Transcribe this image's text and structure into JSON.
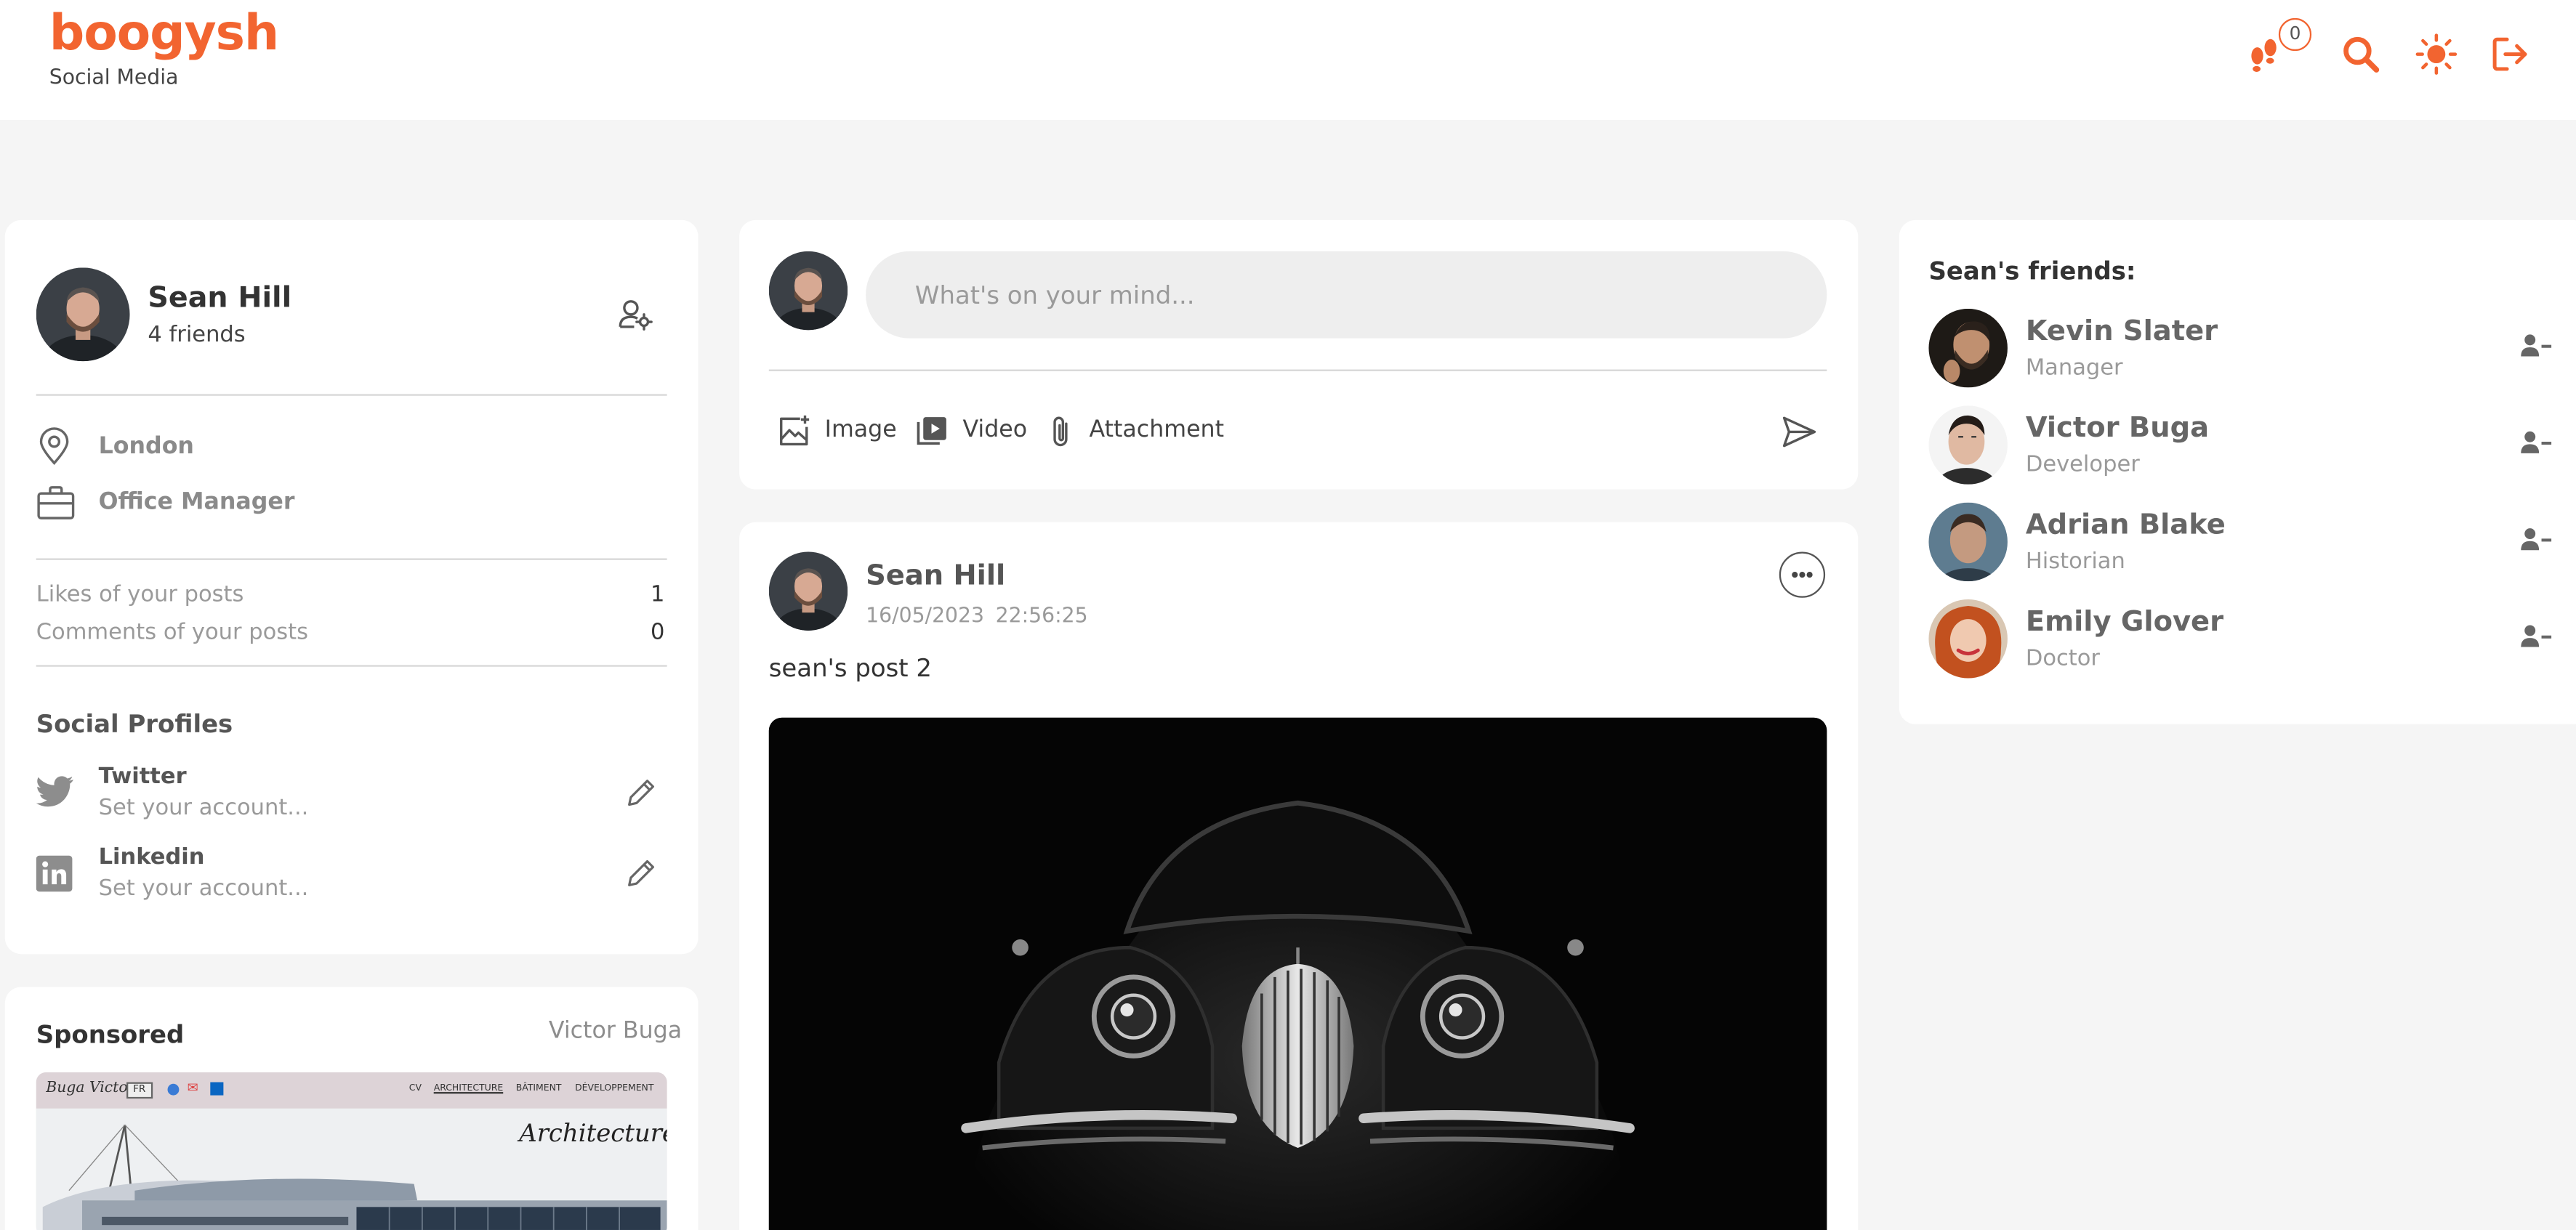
{
  "header": {
    "brand": "boogysh",
    "tagline": "Social Media",
    "notification_count": "0",
    "icons": [
      "footprints-icon",
      "search-icon",
      "sun-icon",
      "logout-icon"
    ],
    "accent_color": "#f26430"
  },
  "profile": {
    "name": "Sean Hill",
    "friends_count": "4 friends",
    "location": "London",
    "occupation": "Office Manager",
    "stats": {
      "likes_label": "Likes of your posts",
      "likes_value": "1",
      "comments_label": "Comments of your posts",
      "comments_value": "0"
    },
    "social": {
      "title": "Social Profiles",
      "items": [
        {
          "name": "Twitter",
          "value": "Set your account..."
        },
        {
          "name": "Linkedin",
          "value": "Set your account..."
        }
      ]
    }
  },
  "sponsored": {
    "title": "Sponsored",
    "author": "Victor Buga",
    "ad": {
      "site_title": "Buga Victor",
      "lang": "FR",
      "nav": [
        "CV",
        "ARCHITECTURE",
        "BÂTIMENT",
        "DÉVELOPPEMENT"
      ],
      "banner_text": "Architecture"
    }
  },
  "composer": {
    "placeholder": "What's on your mind...",
    "value": "",
    "actions": {
      "image": "Image",
      "video": "Video",
      "attachment": "Attachment"
    }
  },
  "post": {
    "author": "Sean Hill",
    "date": "16/05/2023",
    "time": "22:56:25",
    "text": "sean's post 2"
  },
  "friends": {
    "title": "Sean's friends:",
    "items": [
      {
        "name": "Kevin Slater",
        "role": "Manager"
      },
      {
        "name": "Victor Buga",
        "role": "Developer"
      },
      {
        "name": "Adrian Blake",
        "role": "Historian"
      },
      {
        "name": "Emily Glover",
        "role": "Doctor"
      }
    ]
  }
}
